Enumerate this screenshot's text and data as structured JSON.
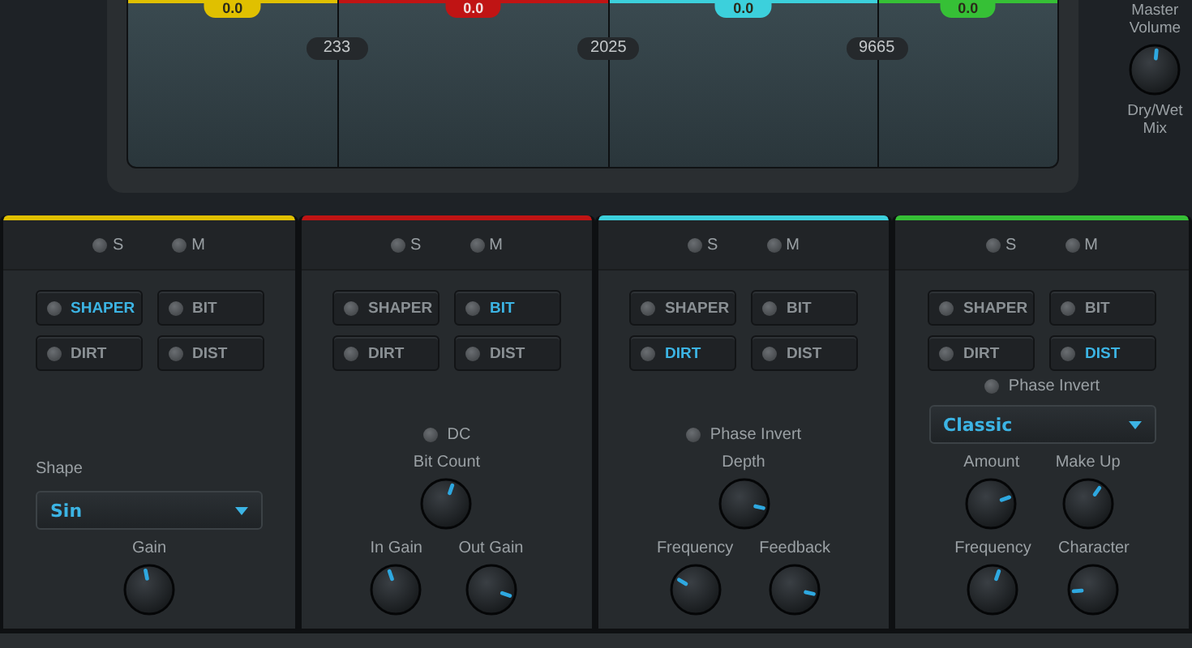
{
  "display": {
    "gains": [
      "0.0",
      "0.0",
      "0.0",
      "0.0"
    ],
    "crossovers": [
      "233",
      "2025",
      "9665"
    ]
  },
  "master": {
    "volume_label": "Master Volume",
    "knob_label": "Dry/Wet Mix",
    "level": 0.52
  },
  "bands": [
    {
      "color": "#e0c000",
      "solo": {
        "label": "S",
        "on": false
      },
      "mute": {
        "label": "M",
        "on": false
      },
      "modes": [
        {
          "label": "SHAPER",
          "selected": true
        },
        {
          "label": "BIT",
          "selected": false
        },
        {
          "label": "DIRT",
          "selected": false
        },
        {
          "label": "DIST",
          "selected": false
        }
      ],
      "rows": [
        [
          {
            "kind": "dropdown",
            "label": "Shape",
            "value": "Sin"
          }
        ],
        [
          {
            "kind": "knob",
            "label": "Gain",
            "level": 0.46
          }
        ]
      ]
    },
    {
      "color": "#c01414",
      "solo": {
        "label": "S",
        "on": false
      },
      "mute": {
        "label": "M",
        "on": false
      },
      "modes": [
        {
          "label": "SHAPER",
          "selected": false
        },
        {
          "label": "BIT",
          "selected": true
        },
        {
          "label": "DIRT",
          "selected": false
        },
        {
          "label": "DIST",
          "selected": false
        }
      ],
      "rows": [
        [
          {
            "kind": "toggle",
            "label": "DC",
            "on": false
          }
        ],
        [
          {
            "kind": "knob",
            "label": "Bit Count",
            "level": 0.57
          }
        ],
        [
          {
            "kind": "knob",
            "label": "In Gain",
            "level": 0.43
          },
          {
            "kind": "knob",
            "label": "Out Gain",
            "level": 0.9
          }
        ]
      ]
    },
    {
      "color": "#3cd0dc",
      "solo": {
        "label": "S",
        "on": false
      },
      "mute": {
        "label": "M",
        "on": false
      },
      "modes": [
        {
          "label": "SHAPER",
          "selected": false
        },
        {
          "label": "BIT",
          "selected": false
        },
        {
          "label": "DIRT",
          "selected": true
        },
        {
          "label": "DIST",
          "selected": false
        }
      ],
      "rows": [
        [
          {
            "kind": "toggle",
            "label": "Phase Invert",
            "on": false
          }
        ],
        [
          {
            "kind": "knob",
            "label": "Depth",
            "level": 0.88
          }
        ],
        [
          {
            "kind": "knob",
            "label": "Frequency",
            "level": 0.28
          },
          {
            "kind": "knob",
            "label": "Feedback",
            "level": 0.88
          }
        ]
      ]
    },
    {
      "color": "#36c036",
      "solo": {
        "label": "S",
        "on": false
      },
      "mute": {
        "label": "M",
        "on": false
      },
      "modes": [
        {
          "label": "SHAPER",
          "selected": false
        },
        {
          "label": "BIT",
          "selected": false
        },
        {
          "label": "DIRT",
          "selected": false
        },
        {
          "label": "DIST",
          "selected": true
        }
      ],
      "rows": [
        [
          {
            "kind": "toggle",
            "label": "Phase Invert",
            "on": false
          }
        ],
        [
          {
            "kind": "dropdown",
            "value": "Classic"
          }
        ],
        [
          {
            "kind": "knob",
            "label": "Amount",
            "level": 0.76
          },
          {
            "kind": "knob",
            "label": "Make Up",
            "level": 0.63
          }
        ],
        [
          {
            "kind": "knob",
            "label": "Frequency",
            "level": 0.57
          },
          {
            "kind": "knob",
            "label": "Character",
            "level": 0.15
          }
        ]
      ]
    }
  ]
}
